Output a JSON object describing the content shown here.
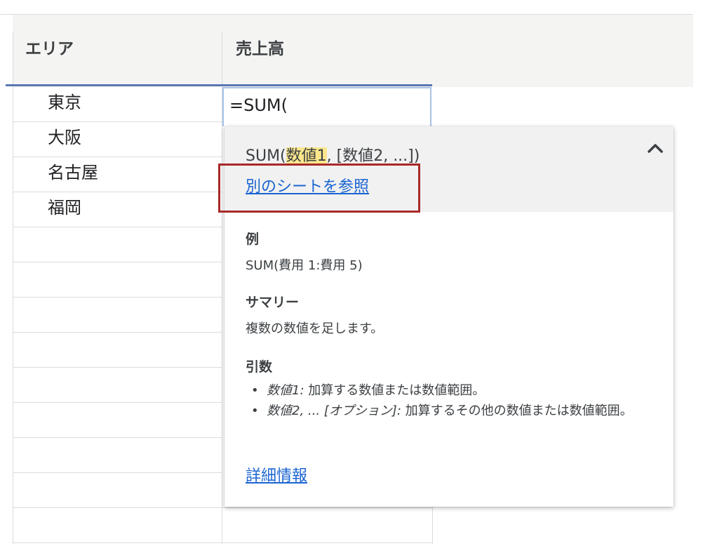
{
  "sheet": {
    "columns": [
      "エリア",
      "売上高"
    ],
    "rows": [
      "東京",
      "大阪",
      "名古屋",
      "福岡"
    ],
    "active_cell_formula": "=SUM("
  },
  "popup": {
    "signature": {
      "name": "SUM(",
      "highlighted_arg": "数値1",
      "rest": ", [数値2, ...])"
    },
    "reference_link": "別のシートを参照",
    "collapse_icon": "chevron-up-icon",
    "example_title": "例",
    "example_text": "SUM(費用 1:費用 5)",
    "summary_title": "サマリー",
    "summary_text": "複数の数値を足します。",
    "args_title": "引数",
    "args": [
      {
        "name": "数値1:",
        "desc": "加算する数値または数値範囲。"
      },
      {
        "name": "数値2, ... [オプション]:",
        "desc": "加算するその他の数値または数値範囲。"
      }
    ],
    "more_link": "詳細情報",
    "colors": {
      "link": "#1a64d2",
      "highlight": "#fbe68c",
      "annotation_box": "#a82a28"
    }
  }
}
